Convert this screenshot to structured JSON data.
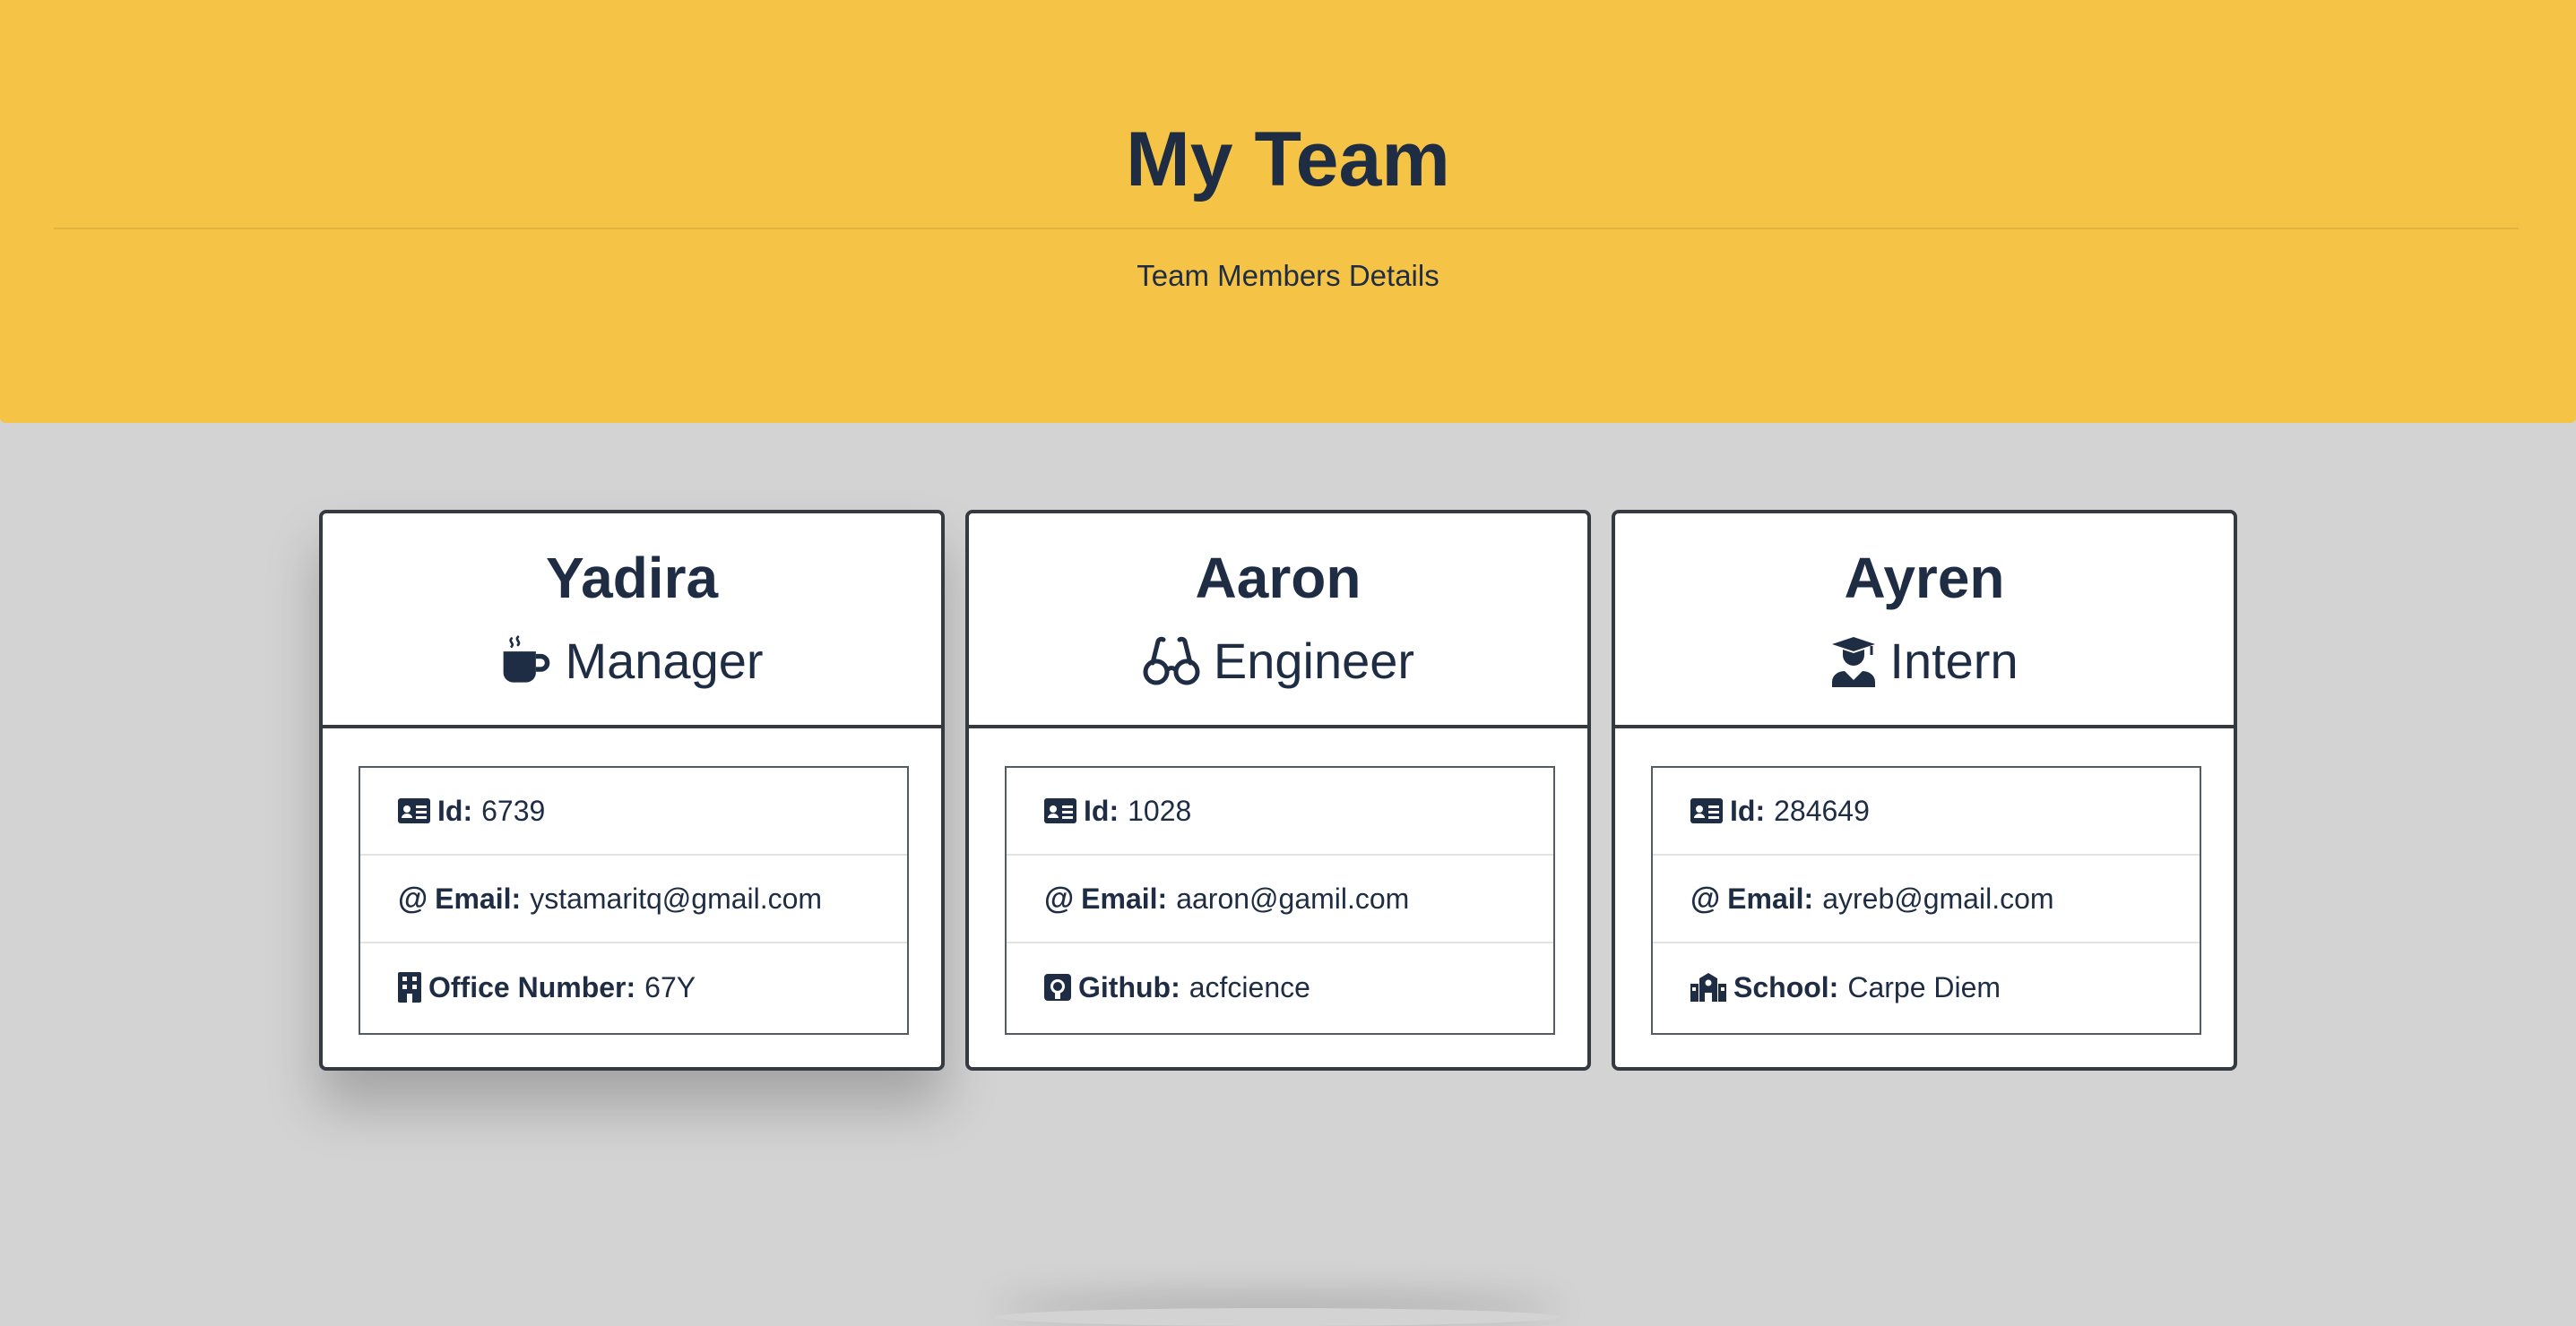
{
  "header": {
    "title": "My Team",
    "subtitle": "Team Members Details",
    "background_color": "#f5c446"
  },
  "page_background": "#d3d3d3",
  "text_color": "#1f2d44",
  "members": [
    {
      "name": "Yadira",
      "role": "Manager",
      "role_icon": "coffee-mug-icon",
      "details": [
        {
          "icon": "id-card-icon",
          "label": "Id:",
          "value": "6739"
        },
        {
          "icon": "at-sign-icon",
          "label": "Email:",
          "value": "ystamaritq@gmail.com"
        },
        {
          "icon": "building-icon",
          "label": "Office Number:",
          "value": "67Y"
        }
      ]
    },
    {
      "name": "Aaron",
      "role": "Engineer",
      "role_icon": "glasses-icon",
      "details": [
        {
          "icon": "id-card-icon",
          "label": "Id:",
          "value": "1028"
        },
        {
          "icon": "at-sign-icon",
          "label": "Email:",
          "value": "aaron@gamil.com"
        },
        {
          "icon": "github-icon",
          "label": "Github:",
          "value": "acfcience"
        }
      ]
    },
    {
      "name": "Ayren",
      "role": "Intern",
      "role_icon": "graduate-icon",
      "details": [
        {
          "icon": "id-card-icon",
          "label": "Id:",
          "value": "284649"
        },
        {
          "icon": "at-sign-icon",
          "label": "Email:",
          "value": "ayreb@gmail.com"
        },
        {
          "icon": "school-icon",
          "label": "School:",
          "value": "Carpe Diem"
        }
      ]
    }
  ]
}
